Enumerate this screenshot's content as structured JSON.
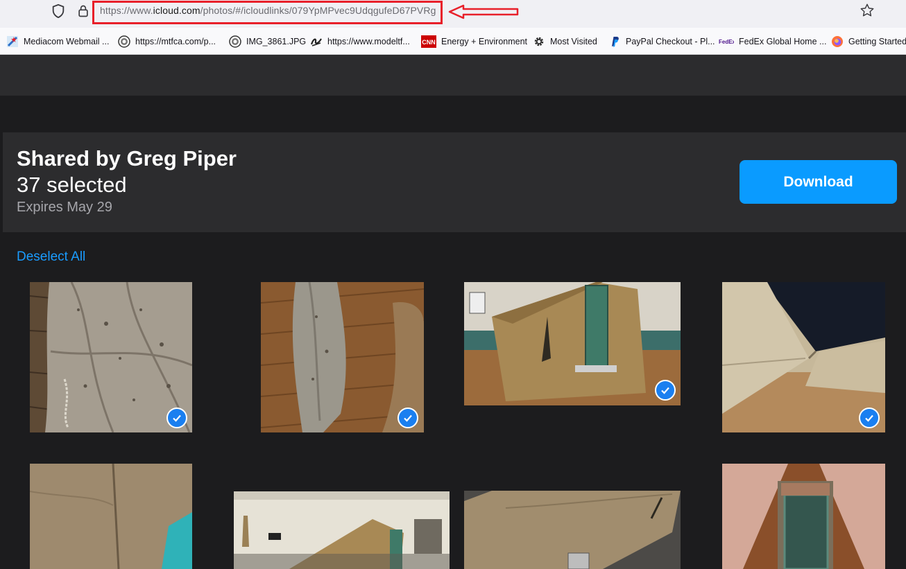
{
  "browser": {
    "url_prefix": "https://www.",
    "url_host": "icloud.com",
    "url_path": "/photos/#/icloudlinks/079YpMPvec9UdqgufeD67PVRg",
    "bookmarks": [
      {
        "label": "Mediacom Webmail ...",
        "icon": "mediacom-icon"
      },
      {
        "label": "https://mtfca.com/p...",
        "icon": "site-seal-icon"
      },
      {
        "label": "IMG_3861.JPG",
        "icon": "site-seal-icon"
      },
      {
        "label": "https://www.modeltf...",
        "icon": "script-logo-icon"
      },
      {
        "label": "Energy + Environment",
        "icon": "cnn-icon"
      },
      {
        "label": "Most Visited",
        "icon": "gear-icon"
      },
      {
        "label": "PayPal Checkout - Pl...",
        "icon": "paypal-icon"
      },
      {
        "label": "FedEx Global Home ...",
        "icon": "fedex-icon"
      },
      {
        "label": "Getting Started",
        "icon": "firefox-icon"
      }
    ],
    "cnn_logo_text": "CNN",
    "fedex_logo_text": "FedEx"
  },
  "header": {
    "shared_by": "Shared by Greg Piper",
    "selected_count": "37 selected",
    "expires": "Expires May 29",
    "download_label": "Download"
  },
  "deselect_label": "Deselect All",
  "photos": [
    {
      "name": "canvas-bag-floor",
      "selected": true
    },
    {
      "name": "canvas-roll-floor",
      "selected": true
    },
    {
      "name": "tent-green-door",
      "selected": true
    },
    {
      "name": "canvas-fold-closeup",
      "selected": true
    },
    {
      "name": "tent-seam-closeup",
      "selected": false
    },
    {
      "name": "tent-hall-wide",
      "selected": false
    },
    {
      "name": "tent-roof-closeup",
      "selected": false
    },
    {
      "name": "tent-door-window",
      "selected": false
    }
  ],
  "colors": {
    "accent": "#0a9bff",
    "link": "#1a9cff",
    "background": "#1c1c1e",
    "panel": "#2c2c2e",
    "highlight": "#e8202a"
  }
}
